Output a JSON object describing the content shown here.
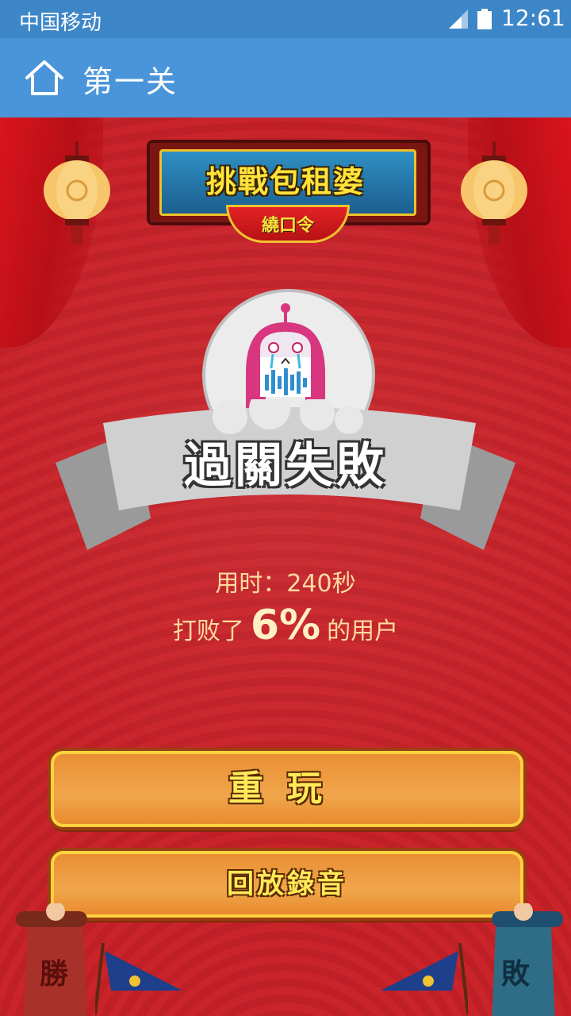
{
  "status_bar": {
    "carrier": "中国移动",
    "time": "12:61",
    "signal_icon": "signal-icon",
    "battery_icon": "battery-icon"
  },
  "app_bar": {
    "home_icon": "home-icon",
    "title": "第一关"
  },
  "stage": {
    "sign_title": "挑戰包租婆",
    "sign_subtitle": "繞口令",
    "result_banner": "過關失敗",
    "time_label": "用时：",
    "time_value": "240秒",
    "beat_prefix": "打败了",
    "beat_percent": "6%",
    "beat_suffix": "的用户",
    "replay_button": "重玩",
    "playback_button": "回放錄音",
    "left_soldier_label": "勝",
    "right_soldier_label": "敗"
  },
  "colors": {
    "status_bar": "#3d87c8",
    "app_bar": "#4a95d9",
    "background_red": "#c82328",
    "button_orange": "#f1a64b",
    "button_border": "#ffd23f",
    "accent_text": "#ffdba0"
  }
}
